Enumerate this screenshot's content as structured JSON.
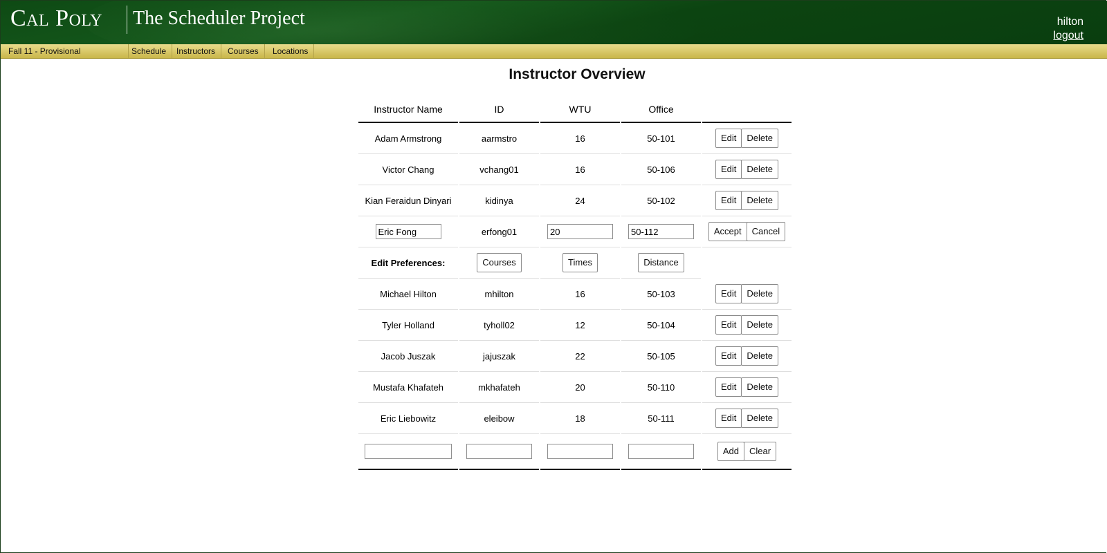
{
  "header": {
    "logo": "Cal Poly",
    "app_title": "The Scheduler Project",
    "user_name": "hilton",
    "logout_label": "logout"
  },
  "nav": {
    "term": "Fall 11 - Provisional",
    "items": [
      {
        "label": "Schedule"
      },
      {
        "label": "Instructors"
      },
      {
        "label": "Courses"
      },
      {
        "label": "Locations"
      }
    ]
  },
  "page": {
    "title": "Instructor Overview"
  },
  "table": {
    "columns": [
      "Instructor Name",
      "ID",
      "WTU",
      "Office"
    ],
    "rows": [
      {
        "name": "Adam Armstrong",
        "id": "aarmstro",
        "wtu": "16",
        "office": "50-101"
      },
      {
        "name": "Victor Chang",
        "id": "vchang01",
        "wtu": "16",
        "office": "50-106"
      },
      {
        "name": "Kian Feraidun Dinyari",
        "id": "kidinya",
        "wtu": "24",
        "office": "50-102"
      }
    ],
    "editing_row": {
      "name": "Eric Fong",
      "id": "erfong01",
      "wtu": "20",
      "office": "50-112"
    },
    "preferences": {
      "label": "Edit Preferences:",
      "courses_label": "Courses",
      "times_label": "Times",
      "distance_label": "Distance"
    },
    "rows_after": [
      {
        "name": "Michael Hilton",
        "id": "mhilton",
        "wtu": "16",
        "office": "50-103"
      },
      {
        "name": "Tyler Holland",
        "id": "tyholl02",
        "wtu": "12",
        "office": "50-104"
      },
      {
        "name": "Jacob Juszak",
        "id": "jajuszak",
        "wtu": "22",
        "office": "50-105"
      },
      {
        "name": "Mustafa Khafateh",
        "id": "mkhafateh",
        "wtu": "20",
        "office": "50-110"
      },
      {
        "name": "Eric Liebowitz",
        "id": "eleibow",
        "wtu": "18",
        "office": "50-111"
      }
    ],
    "new_row": {
      "name": "",
      "id": "",
      "wtu": "",
      "office": ""
    }
  },
  "buttons": {
    "edit": "Edit",
    "delete": "Delete",
    "accept": "Accept",
    "cancel": "Cancel",
    "add": "Add",
    "clear": "Clear"
  },
  "colors": {
    "header_green": "#0e4a14",
    "nav_gold": "#d9c866"
  }
}
